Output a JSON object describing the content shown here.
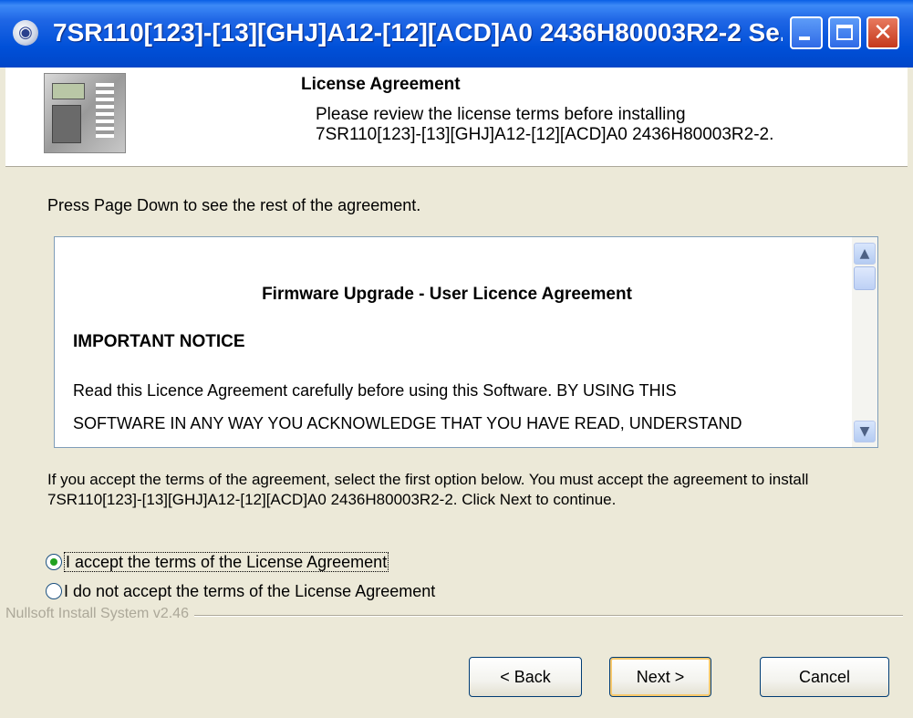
{
  "window": {
    "title": "7SR110[123]-[13][GHJ]A12-[12][ACD]A0 2436H80003R2-2 Se...",
    "minimize_label": "",
    "maximize_label": "",
    "close_label": "✕"
  },
  "header": {
    "title": "License Agreement",
    "subtitle_line1": "Please review the license terms before installing",
    "subtitle_line2": "7SR110[123]-[13][GHJ]A12-[12][ACD]A0 2436H80003R2-2."
  },
  "instructions": "Press Page Down to see the rest of the agreement.",
  "license": {
    "heading": "Firmware Upgrade - User Licence Agreement",
    "notice": "IMPORTANT NOTICE",
    "line1": "Read this Licence Agreement carefully before using this Software. BY USING THIS",
    "line2": "SOFTWARE IN ANY WAY YOU ACKNOWLEDGE THAT YOU HAVE READ, UNDERSTAND"
  },
  "accept_text": "If you accept the terms of the agreement, select the first option below. You must accept the agreement to install 7SR110[123]-[13][GHJ]A12-[12][ACD]A0 2436H80003R2-2. Click Next to continue.",
  "options": {
    "accept": "I accept the terms of the License Agreement",
    "decline": "I do not accept the terms of the License Agreement",
    "selected": "accept"
  },
  "branding": "Nullsoft Install System v2.46",
  "buttons": {
    "back": "< Back",
    "next": "Next >",
    "cancel": "Cancel"
  },
  "colors": {
    "titlebar": "#0050d8",
    "dialog_bg": "#ece9d8",
    "radio_selected": "#21a121",
    "default_button_focus": "#f7c86c"
  },
  "icons": [
    "installer-icon",
    "minimize-icon",
    "maximize-icon",
    "close-icon",
    "device-image",
    "scroll-up-icon",
    "scroll-down-icon"
  ]
}
